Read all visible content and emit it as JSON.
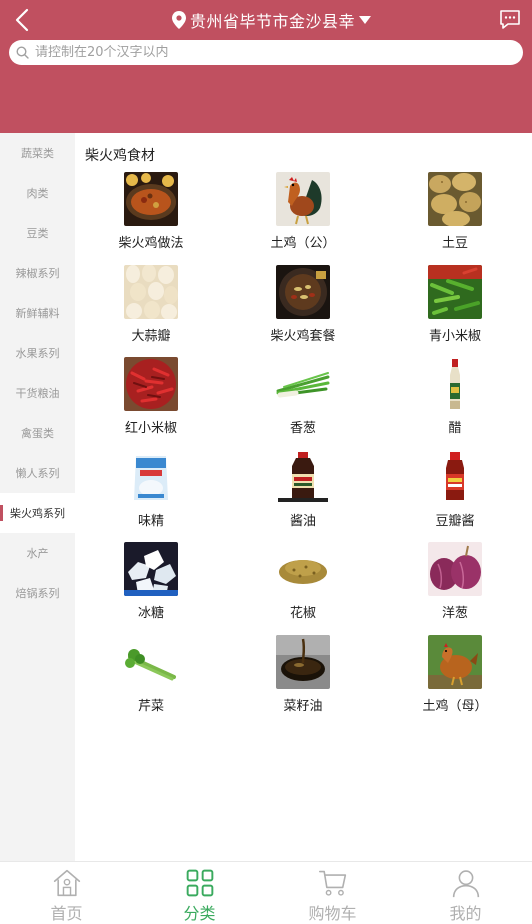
{
  "header": {
    "location": "贵州省毕节市金沙县幸",
    "search_placeholder": "请控制在20个汉字以内"
  },
  "sidebar": {
    "items": [
      {
        "label": "蔬菜类",
        "active": false
      },
      {
        "label": "肉类",
        "active": false
      },
      {
        "label": "豆类",
        "active": false
      },
      {
        "label": "辣椒系列",
        "active": false
      },
      {
        "label": "新鲜辅料",
        "active": false
      },
      {
        "label": "水果系列",
        "active": false
      },
      {
        "label": "干货粮油",
        "active": false
      },
      {
        "label": "禽蛋类",
        "active": false
      },
      {
        "label": "懒人系列",
        "active": false
      },
      {
        "label": "柴火鸡系列",
        "active": true
      },
      {
        "label": "水产",
        "active": false
      },
      {
        "label": "焙锅系列",
        "active": false
      }
    ]
  },
  "content": {
    "section_title": "柴火鸡食材",
    "items": [
      {
        "label": "柴火鸡做法",
        "icon": "chicken-dish-photo"
      },
      {
        "label": "土鸡（公）",
        "icon": "rooster-photo"
      },
      {
        "label": "土豆",
        "icon": "potato-photo"
      },
      {
        "label": "大蒜瓣",
        "icon": "garlic-photo"
      },
      {
        "label": "柴火鸡套餐",
        "icon": "chicken-set-photo"
      },
      {
        "label": "青小米椒",
        "icon": "green-chili-photo"
      },
      {
        "label": "红小米椒",
        "icon": "red-chili-photo"
      },
      {
        "label": "香葱",
        "icon": "scallion-photo"
      },
      {
        "label": "醋",
        "icon": "vinegar-photo"
      },
      {
        "label": "味精",
        "icon": "msg-photo"
      },
      {
        "label": "酱油",
        "icon": "soy-sauce-photo"
      },
      {
        "label": "豆瓣酱",
        "icon": "bean-paste-photo"
      },
      {
        "label": "冰糖",
        "icon": "rock-sugar-photo"
      },
      {
        "label": "花椒",
        "icon": "peppercorn-photo"
      },
      {
        "label": "洋葱",
        "icon": "onion-photo"
      },
      {
        "label": "芹菜",
        "icon": "celery-photo"
      },
      {
        "label": "菜籽油",
        "icon": "rapeseed-oil-photo"
      },
      {
        "label": "土鸡（母）",
        "icon": "hen-photo"
      }
    ]
  },
  "tabbar": {
    "items": [
      {
        "label": "首页",
        "icon": "home-icon",
        "active": false
      },
      {
        "label": "分类",
        "icon": "category-icon",
        "active": true
      },
      {
        "label": "购物车",
        "icon": "cart-icon",
        "active": false
      },
      {
        "label": "我的",
        "icon": "user-icon",
        "active": false
      }
    ]
  },
  "colors": {
    "header_bg": "#c05060",
    "active_tab": "#3aaa5e",
    "inactive_tab": "#b0b0b0"
  }
}
